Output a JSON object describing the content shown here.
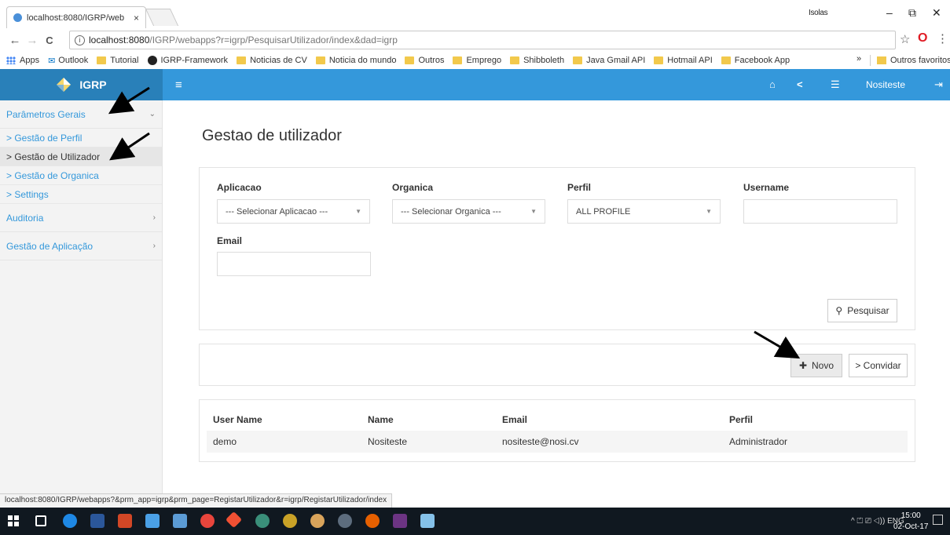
{
  "browser": {
    "tab_title": "localhost:8080/IGRP/web",
    "tab_close": "×",
    "profile": "Isolas",
    "window_controls": {
      "minimize": "–",
      "maximize": "⧉",
      "close": "✕"
    },
    "back": "←",
    "forward": "→",
    "reload": "C",
    "url_host": "localhost:8080",
    "url_path": "/IGRP/webapps?r=igrp/PesquisarUtilizador/index&dad=igrp",
    "info_glyph": "i",
    "star": "☆",
    "opera": "O",
    "menu": "⋮",
    "bookmarks": [
      {
        "label": "Apps",
        "icon": "apps-icon"
      },
      {
        "label": "Outlook",
        "icon": "outlook-icon"
      },
      {
        "label": "Tutorial",
        "icon": "folder-icon"
      },
      {
        "label": "IGRP-Framework",
        "icon": "github-icon"
      },
      {
        "label": "Noticias de CV",
        "icon": "folder-icon"
      },
      {
        "label": "Noticia do mundo",
        "icon": "folder-icon"
      },
      {
        "label": "Outros",
        "icon": "folder-icon"
      },
      {
        "label": "Emprego",
        "icon": "folder-icon"
      },
      {
        "label": "Shibboleth",
        "icon": "folder-icon"
      },
      {
        "label": "Java Gmail API",
        "icon": "folder-icon"
      },
      {
        "label": "Hotmail API",
        "icon": "folder-icon"
      },
      {
        "label": "Facebook App",
        "icon": "folder-icon"
      }
    ],
    "bookmarks_more": "»",
    "other_bookmarks": "Outros favoritos",
    "status_url": "localhost:8080/IGRP/webapps?&prm_app=igrp&prm_page=RegistarUtilizador&r=igrp/RegistarUtilizador/index"
  },
  "header": {
    "brand": "IGRP",
    "menu_toggle": "≡",
    "home_glyph": "⌂",
    "share_glyph": "<",
    "list_glyph": "☰",
    "user": "Nositeste",
    "logout_glyph": "⇥"
  },
  "sidebar": {
    "sections": [
      {
        "label": "Parâmetros Gerais",
        "chevron": "⌄"
      },
      {
        "label": "Auditoria",
        "chevron": "›"
      },
      {
        "label": "Gestão de Aplicação",
        "chevron": "›"
      }
    ],
    "sub_items": [
      {
        "label": "> Gestão de Perfil"
      },
      {
        "label": "> Gestão de Utilizador"
      },
      {
        "label": "> Gestão de Organica"
      },
      {
        "label": "> Settings"
      }
    ]
  },
  "main": {
    "title": "Gestao de utilizador",
    "filters": {
      "aplicacao_label": "Aplicacao",
      "aplicacao_value": "--- Selecionar Aplicacao ---",
      "organica_label": "Organica",
      "organica_value": "--- Selecionar Organica ---",
      "perfil_label": "Perfil",
      "perfil_value": "ALL PROFILE",
      "username_label": "Username",
      "username_value": "",
      "email_label": "Email",
      "email_value": "",
      "caret": "▼"
    },
    "search_button": "Pesquisar",
    "search_glyph": "🔍",
    "new_button": "Novo",
    "new_glyph": "✚",
    "invite_button": "> Convidar",
    "table": {
      "headers": [
        "User Name",
        "Name",
        "Email",
        "Perfil"
      ],
      "rows": [
        [
          "demo",
          "Nositeste",
          "nositeste@nosi.cv",
          "Administrador"
        ]
      ]
    }
  },
  "taskbar": {
    "tray": "^ ⏍ ⎚ ◁)) ENG",
    "time": "15:00",
    "date": "02-Oct-17"
  }
}
